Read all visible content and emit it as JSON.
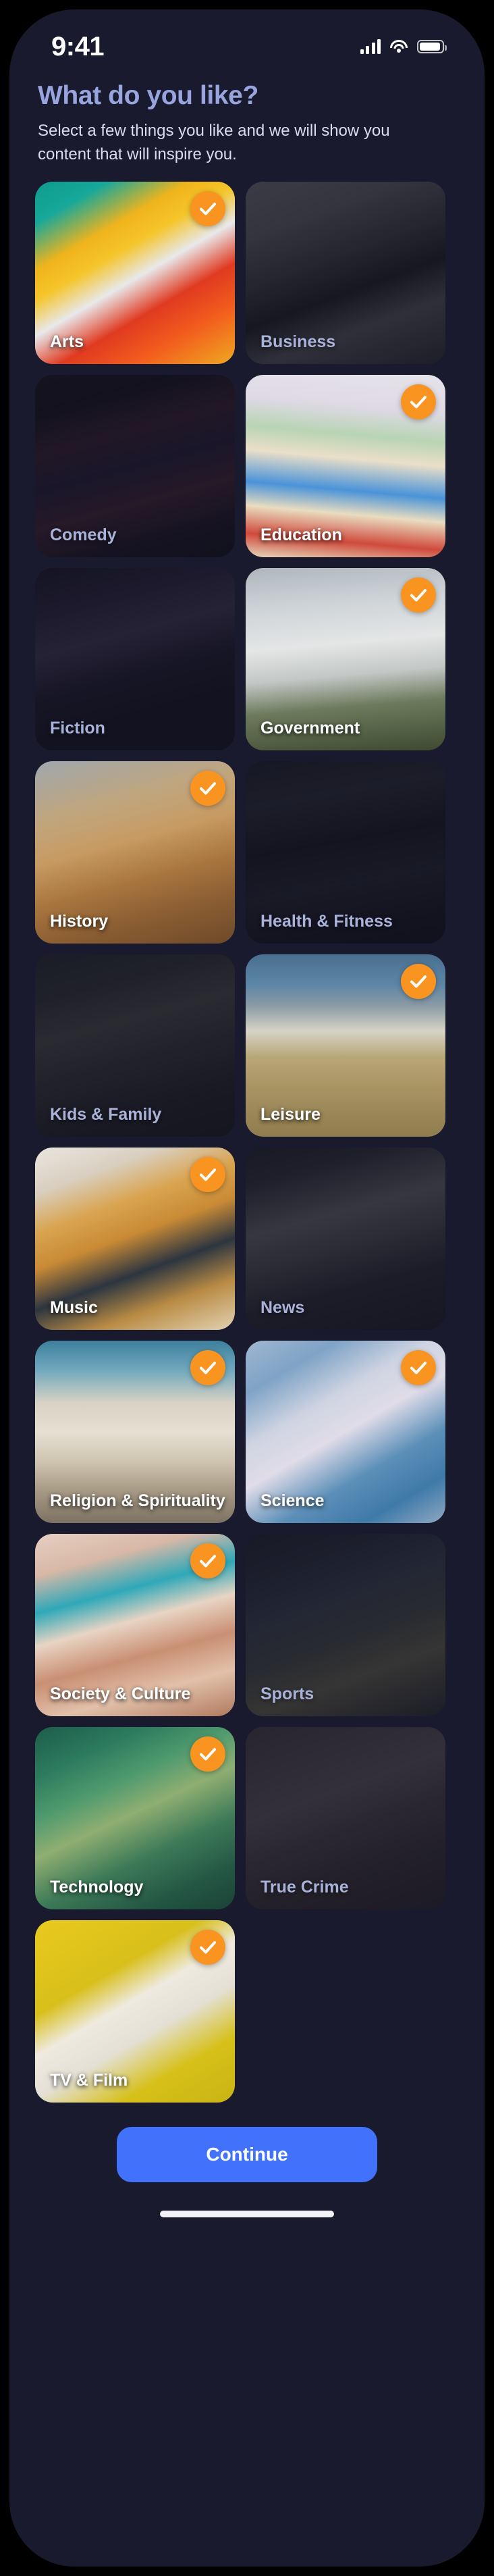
{
  "status_bar": {
    "time": "9:41",
    "icons": [
      "cellular-signal-icon",
      "wifi-icon",
      "battery-icon"
    ]
  },
  "header": {
    "title": "What do you like?",
    "subtitle": "Select a few things you like and we will show you content that will inspire you."
  },
  "colors": {
    "background": "#191a2e",
    "title": "#98a4dd",
    "subtitle": "#d8dcec",
    "check_badge": "#f99420",
    "continue_button": "#4272fb",
    "label_selected": "#ffffff",
    "label_unselected": "#a9b2d8"
  },
  "categories": [
    {
      "label": "Arts",
      "selected": true,
      "image": "linear-gradient(150deg,#0f9b8e 0%,#16a89a 14%,#f0b41c 30%,#f5c52a 40%,#e8e8ea 52%,#e03a20 66%,#f25c1e 80%,#f0a820 100%)"
    },
    {
      "label": "Business",
      "selected": false,
      "image": "linear-gradient(160deg,#dcdcd2 0%,#b9bcae 22%,#6e7268 42%,#2b2d28 58%,#9fa398 74%,#4a4d45 100%)"
    },
    {
      "label": "Comedy",
      "selected": false,
      "image": "linear-gradient(165deg,#2a1a22 0%,#1b1220 16%,#7b2450 34%,#43236e 50%,#9c2b50 66%,#2c1436 84%,#150e1c 100%)"
    },
    {
      "label": "Education",
      "selected": true,
      "image": "linear-gradient(185deg,#e7e3ea 0%,#ded9e4 20%,#b8d4b4 34%,#eadfc8 46%,#4a93d8 62%,#e9dcc0 74%,#d04a3c 88%,#e6d7bb 100%)"
    },
    {
      "label": "Fiction",
      "selected": false,
      "image": "linear-gradient(165deg,#241b3c 0%,#4b3a78 22%,#7a5ea8 38%,#2d2450 56%,#1b1630 74%,#191430 100%)"
    },
    {
      "label": "Government",
      "selected": true,
      "image": "linear-gradient(175deg,#aeb6bd 0%,#cfd4d8 22%,#e4e6e6 42%,#c3c7c6 58%,#6d7a5c 74%,#3d4a32 100%)"
    },
    {
      "label": "History",
      "selected": true,
      "image": "linear-gradient(165deg,#9fa7ad 0%,#c0a67e 26%,#c79b63 44%,#a9763f 62%,#8d5f33 78%,#6d4a2a 100%)"
    },
    {
      "label": "Health & Fitness",
      "selected": false,
      "image": "linear-gradient(170deg,#2c3140 0%,#454b5c 22%,#1c2029 44%,#343a48 64%,#181c24 86%,#12151b 100%)"
    },
    {
      "label": "Kids & Family",
      "selected": false,
      "image": "linear-gradient(165deg,#3c4a3a 0%,#54603f 20%,#8a8d6c 38%,#5d6248 56%,#33392c 78%,#23271e 100%)"
    },
    {
      "label": "Leisure",
      "selected": true,
      "image": "linear-gradient(180deg,#4a6f8f 0%,#5b85a6 16%,#8a9aa5 28%,#d6d3c6 42%,#b9a878 56%,#a99464 72%,#8e7d4e 100%)"
    },
    {
      "label": "Music",
      "selected": true,
      "image": "linear-gradient(160deg,#eae6df 0%,#d9cfc0 18%,#d9a450 34%,#c98a35 48%,#2c3540 64%,#b98b44 80%,#e2d2b2 100%)"
    },
    {
      "label": "News",
      "selected": false,
      "image": "linear-gradient(165deg,#2f3a44 0%,#4a545c 16%,#c9c6bd 38%,#8f8d86 54%,#3d4650 72%,#262d35 100%)"
    },
    {
      "label": "Religion & Spirituality",
      "selected": true,
      "image": "linear-gradient(180deg,#3e7f9c 0%,#6fa8bd 16%,#d8d2c4 34%,#e6e0d2 50%,#cfc5b2 66%,#a89a85 82%,#7d7263 100%)"
    },
    {
      "label": "Science",
      "selected": true,
      "image": "linear-gradient(150deg,#9fb6d0 0%,#7fa3c6 18%,#cfd4e2 36%,#e0dce8 50%,#5c8fb8 68%,#3f7aa8 84%,#8fa8c4 100%)"
    },
    {
      "label": "Society & Culture",
      "selected": true,
      "image": "linear-gradient(165deg,#e6cfc2 0%,#d8b8a6 18%,#2fa8b8 34%,#e8d4c4 48%,#c98f72 64%,#e2c0aa 80%,#b07a5e 100%)"
    },
    {
      "label": "Sports",
      "selected": false,
      "image": "linear-gradient(160deg,#2a3a52 0%,#3c5270 20%,#5a7a92 38%,#7c8f62 56%,#c9c05a 72%,#3a4a40 100%)"
    },
    {
      "label": "Technology",
      "selected": true,
      "image": "linear-gradient(155deg,#1d5c4a 0%,#2c7a5e 18%,#4f9a6e 34%,#8fae72 48%,#3d7a58 66%,#245744 84%,#1a4236 100%)"
    },
    {
      "label": "True Crime",
      "selected": false,
      "image": "linear-gradient(160deg,#8a7068 0%,#a8887c 20%,#c4a292 38%,#8e7468 56%,#6a5248 76%,#4e3c36 100%)"
    },
    {
      "label": "TV & Film",
      "selected": true,
      "image": "linear-gradient(150deg,#e8c91e 0%,#e0c41c 18%,#d8bf1a 32%,#efeae0 46%,#e4e0d6 60%,#d6c018 78%,#c9b414 100%)"
    }
  ],
  "footer": {
    "continue_label": "Continue"
  }
}
